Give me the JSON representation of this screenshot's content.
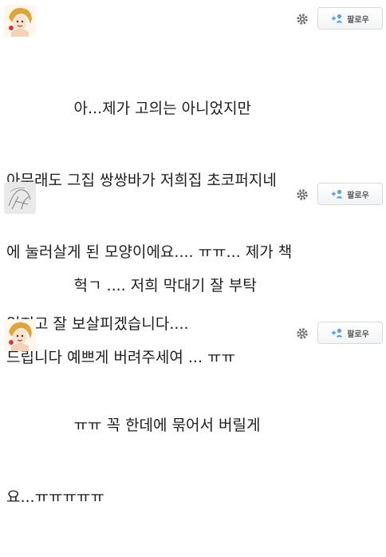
{
  "tweets": [
    {
      "avatar": "avatar-girl-red-hair",
      "follow_label": "팔로우",
      "settings_icon": "gear-icon",
      "lines": [
        "              아...제가 고의는 아니었지만",
        "아무래도 그집 쌍쌍바가 저희집 초코퍼지네",
        "에 눌러살게 된 모양이에요.... ㅠㅠ... 제가 책",
        "임지고 잘 보살피겠습니다...."
      ]
    },
    {
      "avatar": "avatar-sketch",
      "follow_label": "팔로우",
      "settings_icon": "gear-icon",
      "lines": [
        "              헉ㄱ .... 저희 막대기 잘 부탁",
        "드립니다 예쁘게 버려주세여 ... ㅠㅠ"
      ]
    },
    {
      "avatar": "avatar-girl-red-hair",
      "follow_label": "팔로우",
      "settings_icon": "gear-icon",
      "lines": [
        "              ㅠㅠ 꼭 한데에 묶어서 버릴게",
        "요...ㅠㅠㅠㅠㅠ"
      ]
    }
  ]
}
